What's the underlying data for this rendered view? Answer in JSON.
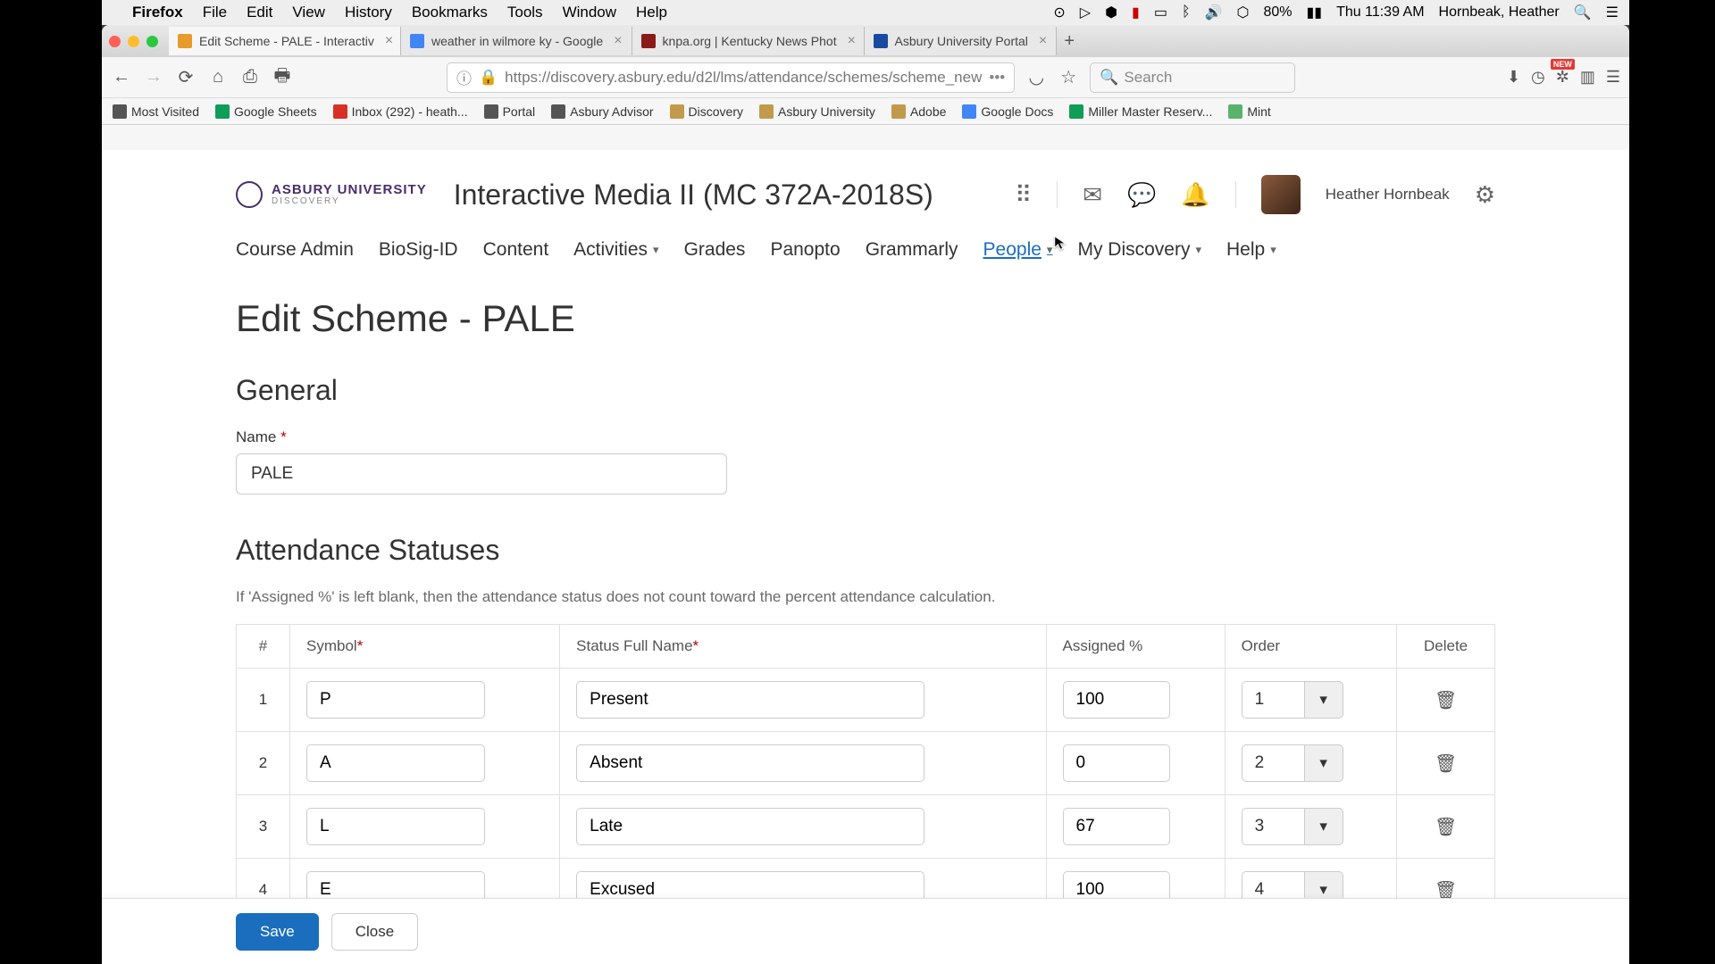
{
  "mac": {
    "app": "Firefox",
    "menus": [
      "File",
      "Edit",
      "View",
      "History",
      "Bookmarks",
      "Tools",
      "Window",
      "Help"
    ],
    "battery": "80%",
    "clock": "Thu 11:39 AM",
    "user": "Hornbeak, Heather"
  },
  "tabs": [
    {
      "label": "Edit Scheme - PALE - Interactiv",
      "active": true,
      "favcolor": "#e69b2b"
    },
    {
      "label": "weather in wilmore ky - Google",
      "active": false,
      "favcolor": "#4285f4"
    },
    {
      "label": "knpa.org | Kentucky News Phot",
      "active": false,
      "favcolor": "#8b1a1a"
    },
    {
      "label": "Asbury University Portal",
      "active": false,
      "favcolor": "#1a4aa0"
    }
  ],
  "url": "https://discovery.asbury.edu/d2l/lms/attendance/schemes/scheme_new",
  "search_placeholder": "Search",
  "bookmarks": [
    {
      "label": "Most Visited",
      "color": "#555"
    },
    {
      "label": "Google Sheets",
      "color": "#0f9d58"
    },
    {
      "label": "Inbox (292) - heath...",
      "color": "#d93025"
    },
    {
      "label": "Portal",
      "color": "#555"
    },
    {
      "label": "Asbury Advisor",
      "color": "#555"
    },
    {
      "label": "Discovery",
      "color": "#c29a4b"
    },
    {
      "label": "Asbury University",
      "color": "#c29a4b"
    },
    {
      "label": "Adobe",
      "color": "#c29a4b"
    },
    {
      "label": "Google Docs",
      "color": "#4285f4"
    },
    {
      "label": "Miller Master Reserv...",
      "color": "#0f9d58"
    },
    {
      "label": "Mint",
      "color": "#59b36a"
    }
  ],
  "lms": {
    "university_name": "ASBURY UNIVERSITY",
    "university_sub": "DISCOVERY",
    "course_title": "Interactive Media II (MC 372A-2018S)",
    "user_name": "Heather Hornbeak",
    "nav": [
      {
        "label": "Course Admin",
        "dropdown": false
      },
      {
        "label": "BioSig-ID",
        "dropdown": false
      },
      {
        "label": "Content",
        "dropdown": false
      },
      {
        "label": "Activities",
        "dropdown": true
      },
      {
        "label": "Grades",
        "dropdown": false
      },
      {
        "label": "Panopto",
        "dropdown": false
      },
      {
        "label": "Grammarly",
        "dropdown": false
      },
      {
        "label": "People",
        "dropdown": true,
        "active": true
      },
      {
        "label": "My Discovery",
        "dropdown": true
      },
      {
        "label": "Help",
        "dropdown": true
      }
    ]
  },
  "form": {
    "page_title": "Edit Scheme - PALE",
    "general_heading": "General",
    "name_label": "Name",
    "name_value": "PALE",
    "statuses_heading": "Attendance Statuses",
    "hint": "If 'Assigned %' is left blank, then the attendance status does not count toward the percent attendance calculation.",
    "columns": {
      "num": "#",
      "symbol": "Symbol",
      "status_name": "Status Full Name",
      "assigned": "Assigned %",
      "order": "Order",
      "delete": "Delete"
    },
    "rows": [
      {
        "num": "1",
        "symbol": "P",
        "name": "Present",
        "pct": "100",
        "order": "1"
      },
      {
        "num": "2",
        "symbol": "A",
        "name": "Absent",
        "pct": "0",
        "order": "2"
      },
      {
        "num": "3",
        "symbol": "L",
        "name": "Late",
        "pct": "67",
        "order": "3"
      },
      {
        "num": "4",
        "symbol": "E",
        "name": "Excused",
        "pct": "100",
        "order": "4"
      }
    ],
    "save_label": "Save",
    "close_label": "Close"
  }
}
